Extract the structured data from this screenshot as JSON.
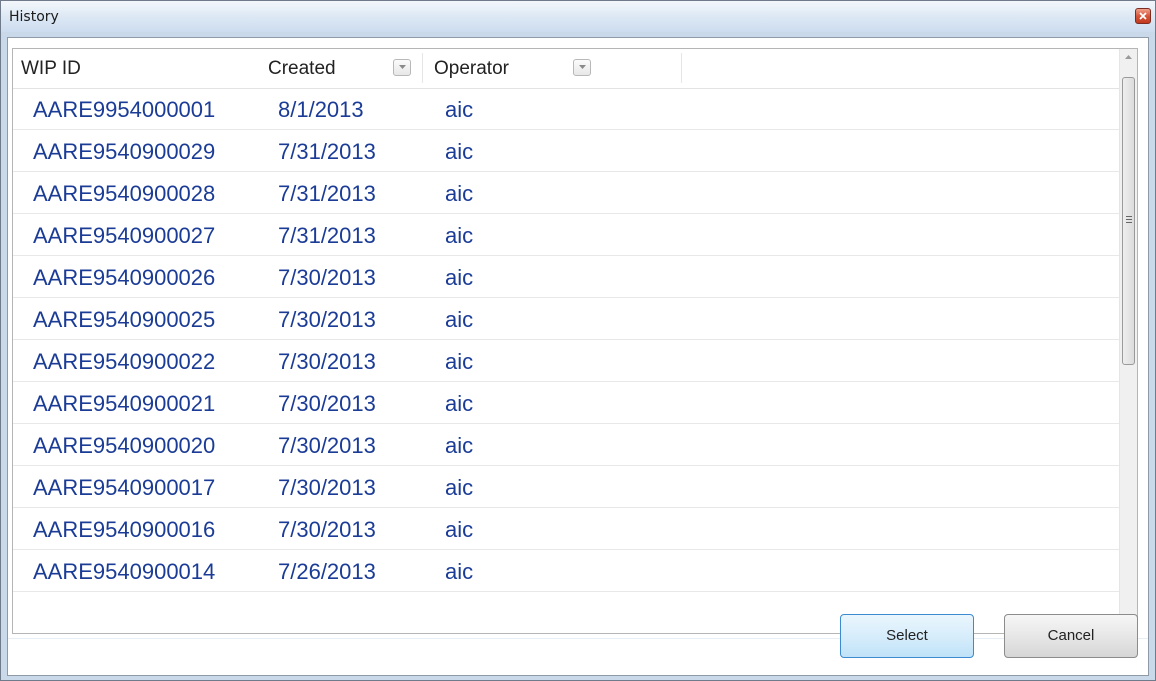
{
  "window": {
    "title": "History"
  },
  "grid": {
    "columns": [
      {
        "label": "WIP ID",
        "filterable": false
      },
      {
        "label": "Created",
        "filterable": true
      },
      {
        "label": "Operator",
        "filterable": true
      }
    ],
    "rows": [
      {
        "wip_id": "AARE9954000001",
        "created": "8/1/2013",
        "operator": "aic"
      },
      {
        "wip_id": "AARE9540900029",
        "created": "7/31/2013",
        "operator": "aic"
      },
      {
        "wip_id": "AARE9540900028",
        "created": "7/31/2013",
        "operator": "aic"
      },
      {
        "wip_id": "AARE9540900027",
        "created": "7/31/2013",
        "operator": "aic"
      },
      {
        "wip_id": "AARE9540900026",
        "created": "7/30/2013",
        "operator": "aic"
      },
      {
        "wip_id": "AARE9540900025",
        "created": "7/30/2013",
        "operator": "aic"
      },
      {
        "wip_id": "AARE9540900022",
        "created": "7/30/2013",
        "operator": "aic"
      },
      {
        "wip_id": "AARE9540900021",
        "created": "7/30/2013",
        "operator": "aic"
      },
      {
        "wip_id": "AARE9540900020",
        "created": "7/30/2013",
        "operator": "aic"
      },
      {
        "wip_id": "AARE9540900017",
        "created": "7/30/2013",
        "operator": "aic"
      },
      {
        "wip_id": "AARE9540900016",
        "created": "7/30/2013",
        "operator": "aic"
      },
      {
        "wip_id": "AARE9540900014",
        "created": "7/26/2013",
        "operator": "aic"
      }
    ]
  },
  "buttons": {
    "select_label": "Select",
    "cancel_label": "Cancel"
  },
  "icons": {
    "close": "close-icon",
    "filter": "filter-dropdown-icon",
    "scroll_up": "scroll-up-arrow-icon",
    "scroll_down": "scroll-down-arrow-icon",
    "thumb_grip": "scrollbar-grip-icon"
  },
  "colors": {
    "cell_text": "#1b3c96",
    "select_border": "#3c8ad1",
    "close_button": "#c2391f",
    "titlebar": "#dbe7f4"
  }
}
